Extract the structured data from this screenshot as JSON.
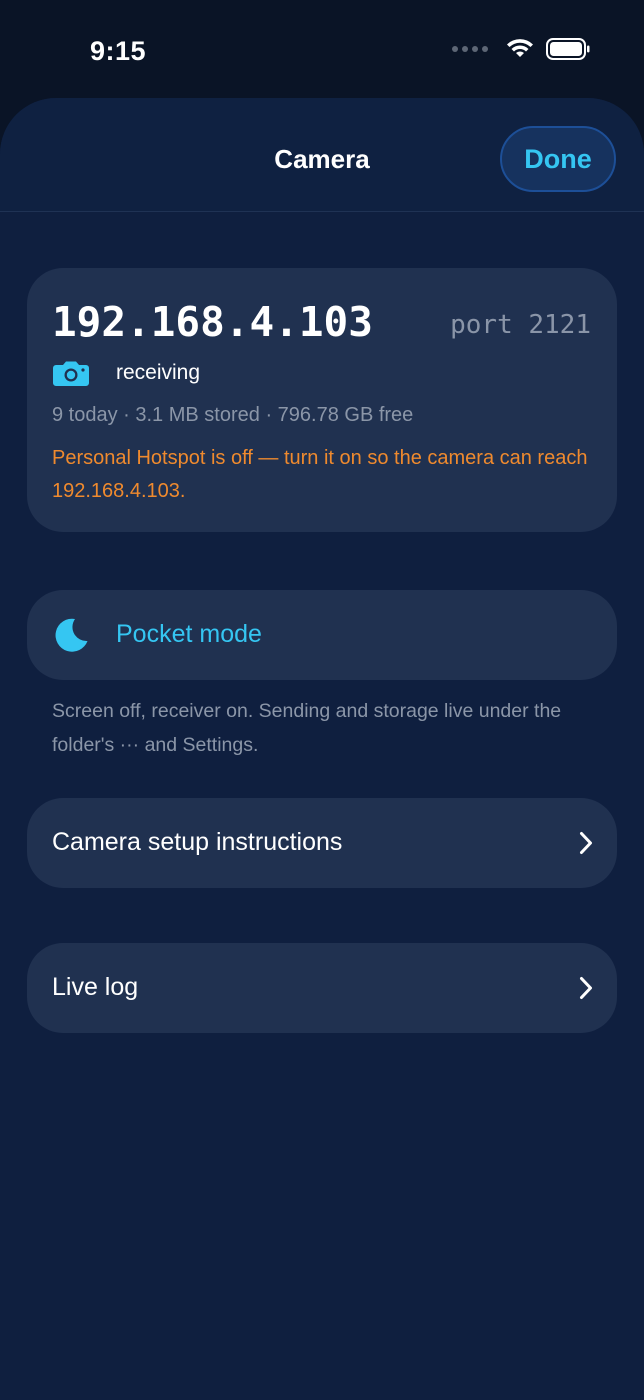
{
  "status_bar": {
    "time": "9:15",
    "icons": [
      "cellular-dots-icon",
      "wifi-icon",
      "battery-icon"
    ]
  },
  "header": {
    "title": "Camera",
    "done_label": "Done"
  },
  "receiver": {
    "ip_address": "192.168.4.103",
    "port": "port 2121",
    "status_icon": "camera-icon",
    "status": "receiving",
    "stats": "9 today · 3.1 MB stored · 796.78 GB free",
    "warning": "Personal Hotspot is off — turn it on so the camera can reach 192.168.4.103."
  },
  "pocket_mode": {
    "icon": "moon-icon",
    "label": "Pocket mode",
    "footnote": "Screen off, receiver on. Sending and storage live under the folder's ··· and Settings."
  },
  "rows": [
    {
      "label": "Camera setup instructions",
      "icon": "chevron-right-icon"
    },
    {
      "label": "Live log",
      "icon": "chevron-right-icon"
    }
  ],
  "colors": {
    "background": "#0a1426",
    "sheet": "#0f1f3f",
    "card": "#203150",
    "accent": "#35c6f2",
    "warning": "#ef8a2e",
    "secondary_text": "#8b96a8"
  }
}
